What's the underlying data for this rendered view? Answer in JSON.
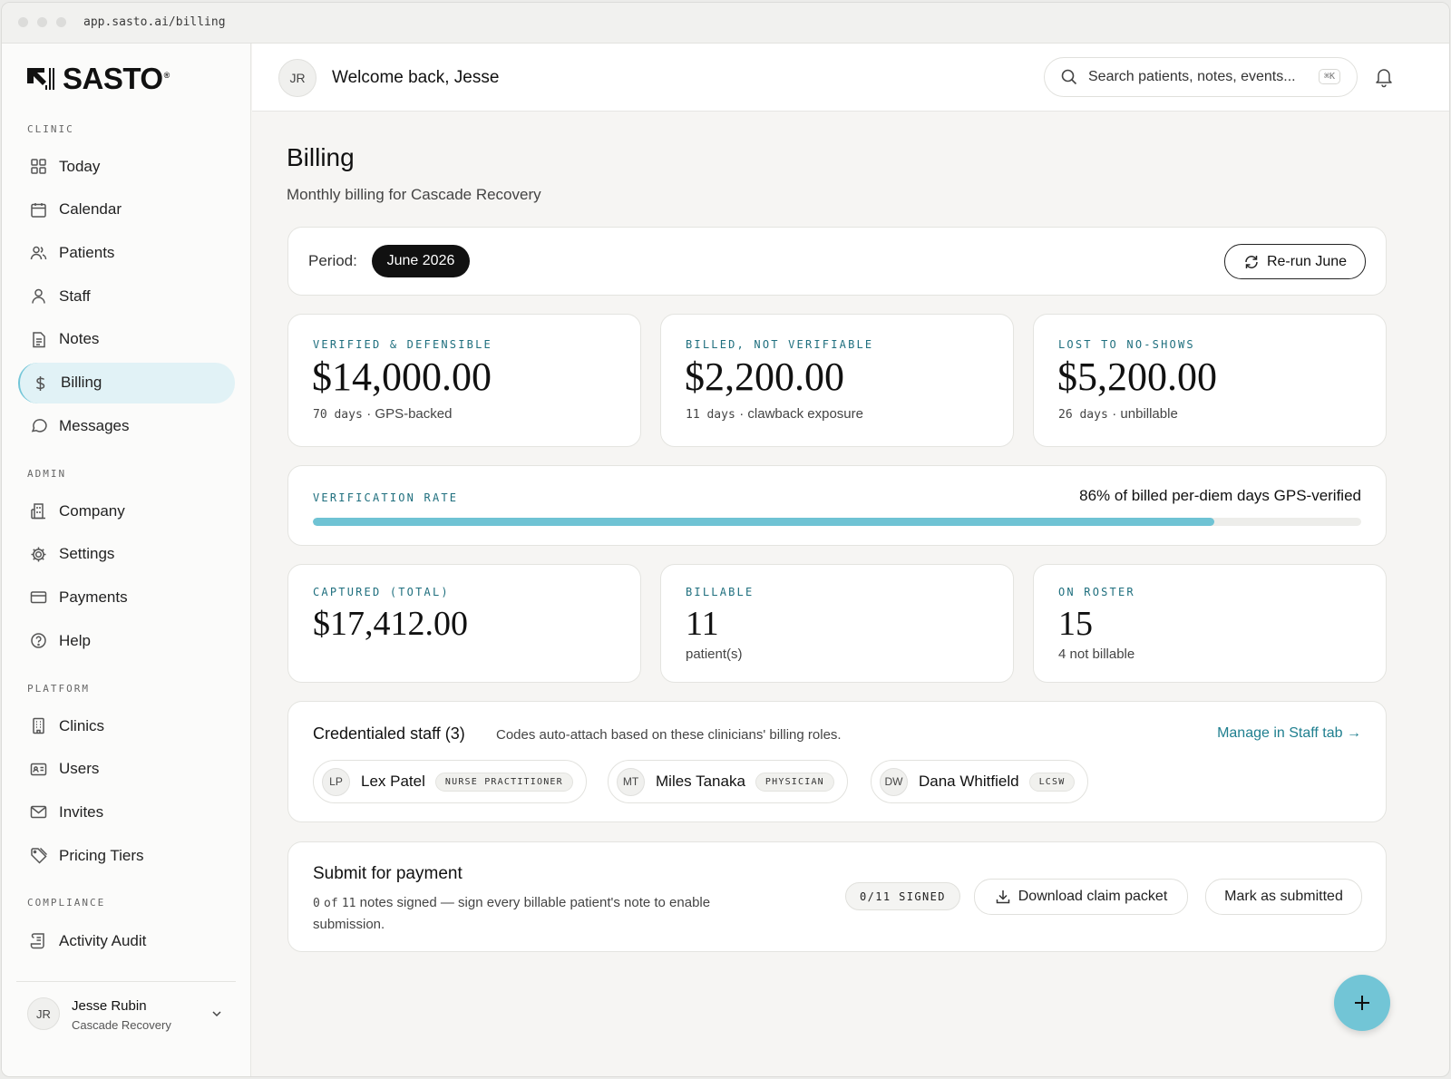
{
  "browser": {
    "url": "app.sasto.ai/billing"
  },
  "brand": {
    "name": "SASTO",
    "reg": "®"
  },
  "sidebar": {
    "sections": [
      {
        "label": "CLINIC",
        "items": [
          {
            "label": "Today",
            "icon": "grid-icon"
          },
          {
            "label": "Calendar",
            "icon": "calendar-icon"
          },
          {
            "label": "Patients",
            "icon": "users-icon"
          },
          {
            "label": "Staff",
            "icon": "user-icon"
          },
          {
            "label": "Notes",
            "icon": "document-icon"
          },
          {
            "label": "Billing",
            "icon": "dollar-icon",
            "active": true
          },
          {
            "label": "Messages",
            "icon": "chat-icon"
          }
        ]
      },
      {
        "label": "ADMIN",
        "items": [
          {
            "label": "Company",
            "icon": "building-icon"
          },
          {
            "label": "Settings",
            "icon": "gear-icon"
          },
          {
            "label": "Payments",
            "icon": "card-icon"
          },
          {
            "label": "Help",
            "icon": "help-icon"
          }
        ]
      },
      {
        "label": "PLATFORM",
        "items": [
          {
            "label": "Clinics",
            "icon": "office-icon"
          },
          {
            "label": "Users",
            "icon": "id-card-icon"
          },
          {
            "label": "Invites",
            "icon": "mail-icon"
          },
          {
            "label": "Pricing Tiers",
            "icon": "tag-icon"
          }
        ]
      },
      {
        "label": "COMPLIANCE",
        "items": [
          {
            "label": "Activity Audit",
            "icon": "scroll-icon"
          }
        ]
      }
    ],
    "user": {
      "initials": "JR",
      "name": "Jesse Rubin",
      "org": "Cascade Recovery"
    }
  },
  "header": {
    "initials": "JR",
    "welcome": "Welcome back, Jesse",
    "search_placeholder": "Search patients, notes, events...",
    "search_shortcut": "⌘K"
  },
  "page": {
    "title": "Billing",
    "subtitle": "Monthly billing for Cascade Recovery",
    "period_label": "Period:",
    "period_value": "June 2026",
    "rerun_label": "Re-run June"
  },
  "stats": [
    {
      "label": "VERIFIED & DEFENSIBLE",
      "value": "$14,000.00",
      "days": "70 days",
      "note": "· GPS-backed"
    },
    {
      "label": "BILLED, NOT VERIFIABLE",
      "value": "$2,200.00",
      "days": "11 days",
      "note": "· clawback exposure"
    },
    {
      "label": "LOST TO NO-SHOWS",
      "value": "$5,200.00",
      "days": "26 days",
      "note": "· unbillable"
    }
  ],
  "verification": {
    "label": "VERIFICATION RATE",
    "summary": "86% of billed per-diem days GPS-verified",
    "rate": 0.86,
    "bar_color": "#6fc3d4"
  },
  "totals": [
    {
      "label": "CAPTURED (TOTAL)",
      "value": "$17,412.00",
      "sub": ""
    },
    {
      "label": "BILLABLE",
      "value": "11",
      "sub": "patient(s)"
    },
    {
      "label": "ON ROSTER",
      "value": "15",
      "sub": "4 not billable"
    }
  ],
  "staff": {
    "title": "Credentialed staff (3)",
    "description": "Codes auto-attach based on these clinicians' billing roles.",
    "manage_link": "Manage in Staff tab →",
    "members": [
      {
        "initials": "LP",
        "name": "Lex Patel",
        "role": "NURSE PRACTITIONER"
      },
      {
        "initials": "MT",
        "name": "Miles Tanaka",
        "role": "PHYSICIAN"
      },
      {
        "initials": "DW",
        "name": "Dana Whitfield",
        "role": "LCSW"
      }
    ]
  },
  "submit": {
    "title": "Submit for payment",
    "count_signed": "0",
    "of_word": "of",
    "count_total": "11",
    "desc_line1": "notes signed — sign every billable patient's note to enable",
    "desc_line2": "submission.",
    "signed_badge": "0/11 SIGNED",
    "download_label": "Download claim packet",
    "mark_label": "Mark as submitted"
  },
  "colors": {
    "accent": "#6fc3d4",
    "teal_label": "#1f6f7e",
    "link": "#1f7f8f"
  }
}
